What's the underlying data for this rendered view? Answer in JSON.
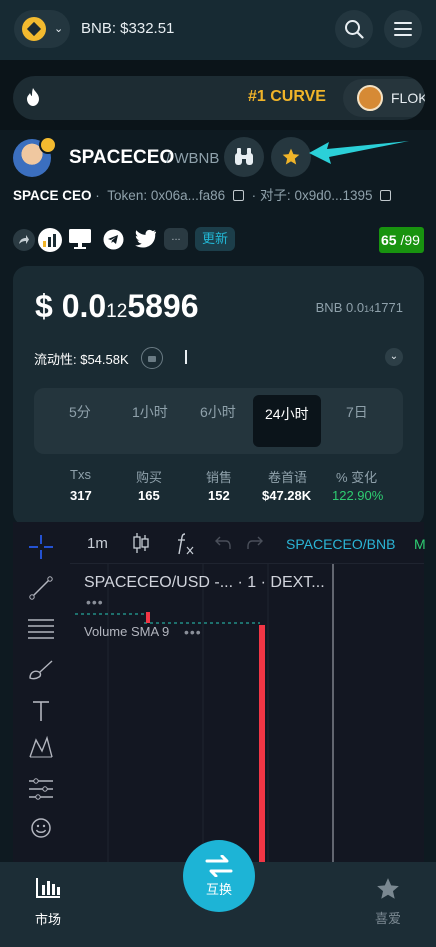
{
  "header": {
    "bnb_balance": "BNB: $332.51",
    "chain_icon": "bnb-logo",
    "search_icon": "search-icon",
    "menu_icon": "hamburger-icon"
  },
  "trending": {
    "rank_text": "#1 CURVE",
    "token": "FLOKI"
  },
  "token": {
    "symbol": "SPACECEO",
    "pair_sep": "/",
    "quote": "WBNB",
    "brand": "SPACE CEO",
    "dot": "·",
    "token_addr": "Token: 0x06a...fa86",
    "pair_addr": "对子: 0x9d0...1395"
  },
  "social": {
    "more_label": "...",
    "new_label": "更新",
    "score": "65",
    "score_total": "/99"
  },
  "price": {
    "usd_prefix": "$ 0.0",
    "usd_sub": "12",
    "usd_rest": "5896",
    "bnb_prefix": "BNB 0.0",
    "bnb_sub": "14",
    "bnb_rest": "1771",
    "liquidity": "流动性: $54.58K",
    "expand_icon": "chevron-down-icon"
  },
  "timeframes": [
    {
      "label": "5分"
    },
    {
      "label": "1小时"
    },
    {
      "label": "6小时"
    },
    {
      "label": "24小时",
      "active": true
    },
    {
      "label": "7日"
    }
  ],
  "stats": [
    {
      "label": "Txs",
      "value": "317"
    },
    {
      "label": "购买",
      "value": "165"
    },
    {
      "label": "销售",
      "value": "152"
    },
    {
      "label": "卷首语",
      "value": "$47.28K"
    },
    {
      "label": "% 变化",
      "value": "122.90%"
    }
  ],
  "chart": {
    "interval": "1m",
    "pair": "SPACECEO/BNB",
    "pair_extra": "M",
    "legend_title": "SPACECEO/USD -... · 1 · DEXT...",
    "volume_label": "Volume SMA 9",
    "up_color": "#f23645",
    "line_color": "#26a69a"
  },
  "bottom_nav": {
    "market": "市场",
    "swap": "互换",
    "favorites": "喜爱"
  },
  "colors": {
    "accent": "#1db4d6",
    "gold": "#f0b429",
    "green": "#2ecc71",
    "score_bg": "#18930f"
  }
}
